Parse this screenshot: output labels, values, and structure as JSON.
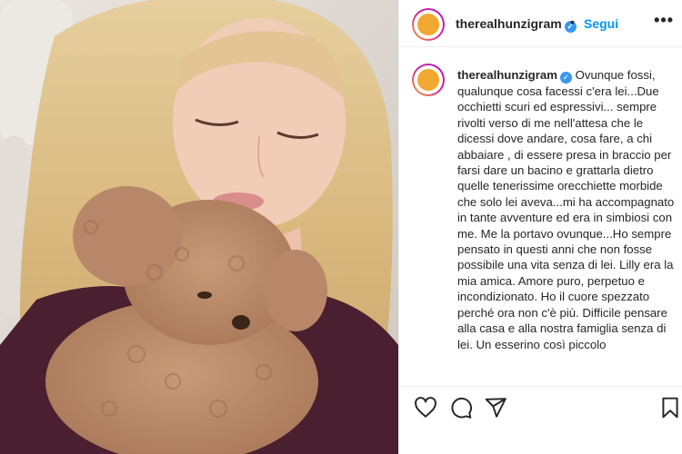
{
  "post": {
    "username": "therealhunzigram",
    "follow_label": "Segui",
    "separator": "•",
    "more_label": "•••",
    "caption_username": "therealhunzigram",
    "caption_text": "Ovunque fossi, qualunque cosa facessi c'era lei...Due occhietti scuri ed espressivi... sempre rivolti verso di me nell'attesa che le dicessi dove andare, cosa fare, a chi abbaiare , di essere presa in braccio per farsi dare un bacino e grattarla dietro quelle tenerissime orecchiette morbide che solo lei aveva...mi ha accompagnato in tante avventure ed era in simbiosi con me. Me la portavo ovunque...Ho sempre pensato in questi anni che non fosse possibile una vita senza di lei. Lilly era la mia amica. Amore puro, perpetuo e incondizionato. Ho il cuore spezzato perché ora non c'è più. Difficile pensare alla casa e alla nostra famiglia senza di lei. Un esserino così piccolo"
  },
  "icons": {
    "verified": "verified-badge-icon",
    "like": "heart-icon",
    "comment": "comment-icon",
    "share": "send-icon",
    "save": "bookmark-icon"
  },
  "colors": {
    "accent": "#0095f6",
    "text": "#262626",
    "verified": "#3897f0",
    "border": "#efefef"
  }
}
